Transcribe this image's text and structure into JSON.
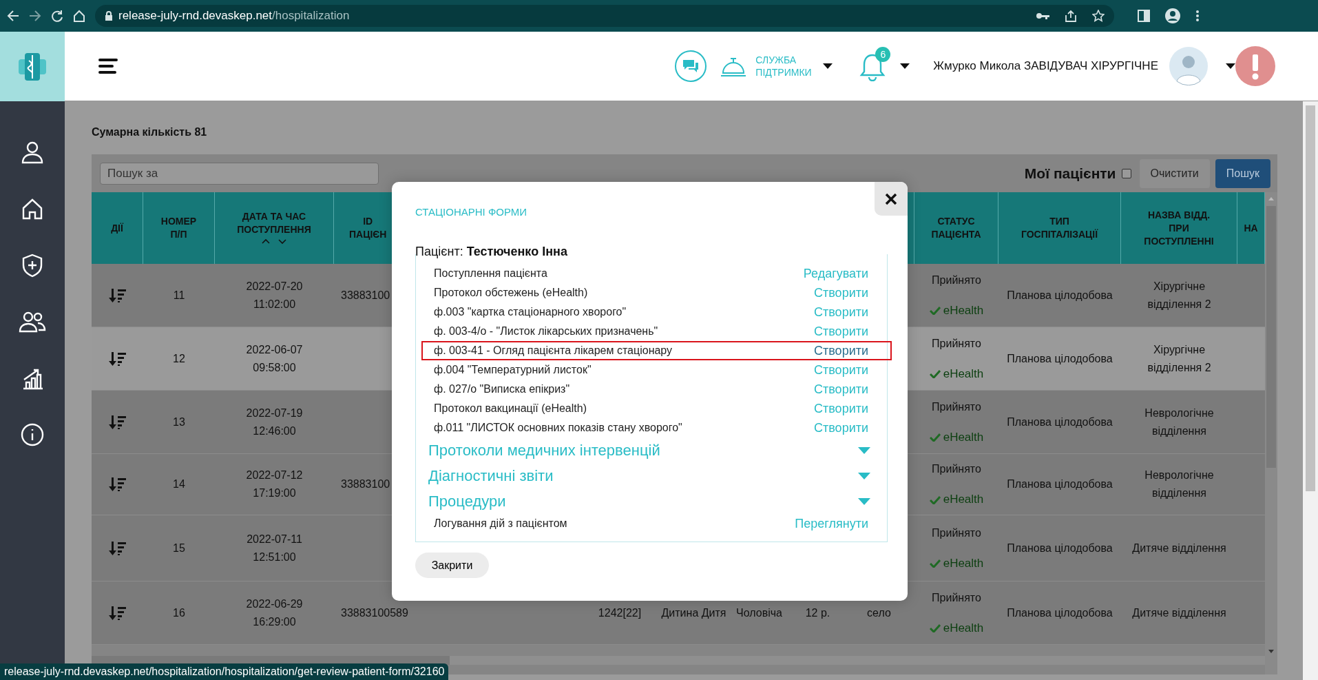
{
  "browser": {
    "address_bar": {
      "host": "release-july-rnd.devaskep.net",
      "path": "/hospitalization"
    }
  },
  "header": {
    "support_label": "СЛУЖБА ПІДТРИМКИ",
    "notification_count": "6",
    "user_name": "Жмурко Микола ЗАВІДУВАЧ ХІРУРГІЧНЕ"
  },
  "summary": "Сумарна кількість 81",
  "toolbar": {
    "search": {
      "placeholder": "Пошук за"
    },
    "my_patients": {
      "label": "Мої пацієнти",
      "checked": false
    },
    "clear_button": "Очистити",
    "search_button": "Пошук"
  },
  "table": {
    "columns": [
      {
        "label": "ДІЇ",
        "sortable": false
      },
      {
        "label": "НОМЕР\nП/П",
        "sortable": false
      },
      {
        "label": "ДАТА ТА ЧАС\nПОСТУПЛЕННЯ",
        "sortable": true
      },
      {
        "label": "ID\nПАЦІЄН",
        "sortable": false
      },
      {},
      {},
      {},
      {},
      {},
      {
        "label": "СТАТУС\nПАЦІЄНТА",
        "sortable": false
      },
      {
        "label": "ТИП\nГОСПІТАЛІЗАЦІЇ",
        "sortable": false
      },
      {
        "label": "НАЗВА ВІДД.\nПРИ\nПОСТУПЛЕННІ",
        "sortable": false
      },
      {
        "label": "НА",
        "sortable": false
      }
    ],
    "rows": [
      {
        "number": "11",
        "date": "2022-07-20",
        "time": "11:02:00",
        "patient_id": "33883100",
        "status": "Прийнято",
        "ehealth": "eHealth",
        "hospitalization_type": "Планова цілодобова",
        "department": "Хірургічне відділення 2",
        "highlighted": false
      },
      {
        "number": "12",
        "date": "2022-06-07",
        "time": "09:58:00",
        "status": "Прийнято",
        "ehealth": "eHealth",
        "hospitalization_type": "Планова цілодобова",
        "department": "Хірургічне відділення 2",
        "highlighted": true
      },
      {
        "number": "13",
        "date": "2022-07-19",
        "time": "12:46:00",
        "status": "Прийнято",
        "ehealth": "eHealth",
        "hospitalization_type": "Планова цілодобова",
        "department": "Неврологічне відділення",
        "highlighted": false
      },
      {
        "number": "14",
        "date": "2022-07-12",
        "time": "17:19:00",
        "patient_id": "33883100",
        "status": "Прийнято",
        "ehealth": "eHealth",
        "hospitalization_type": "Планова цілодобова",
        "department": "Неврологічне відділення",
        "highlighted": false
      },
      {
        "number": "15",
        "date": "2022-07-11",
        "time": "12:51:00",
        "status": "Прийнято",
        "ehealth": "eHealth",
        "hospitalization_type": "Планова цілодобова",
        "department": "Дитяче відділення",
        "highlighted": false
      },
      {
        "number": "16",
        "date": "2022-06-29",
        "time": "16:29:00",
        "patient_id": "33883100589",
        "column_5": "1242[22]",
        "column_6": "Дитина Дитя",
        "column_7": "Чоловіча",
        "column_8": "12 р.",
        "column_9": "село",
        "status": "Прийнято",
        "ehealth": "eHealth",
        "hospitalization_type": "Планова цілодобова",
        "department": "Дитяче відділення",
        "highlighted": false
      }
    ]
  },
  "modal": {
    "title": "СТАЦІОНАРНІ ФОРМИ",
    "patient_label": "Пацієнт:",
    "patient_name": "Тестюченко Інна",
    "items": [
      {
        "kind": "form",
        "label": "Поступлення пацієнта",
        "action": "Редагувати",
        "highlighted": false
      },
      {
        "kind": "form",
        "label": "Протокол обстежень (eHealth)",
        "action": "Створити",
        "highlighted": false
      },
      {
        "kind": "form",
        "label": "ф.003 \"картка стаціонарного хворого\"",
        "action": "Створити",
        "highlighted": false
      },
      {
        "kind": "form",
        "label": "ф. 003-4/о - \"Листок лікарських призначень\"",
        "action": "Створити",
        "highlighted": false
      },
      {
        "kind": "form",
        "label": "ф. 003-41 - Огляд пацієнта лікарем стаціонару",
        "action": "Створити",
        "highlighted": true
      },
      {
        "kind": "form",
        "label": "ф.004 \"Температурний листок\"",
        "action": "Створити",
        "highlighted": false
      },
      {
        "kind": "form",
        "label": "ф. 027/о \"Виписка епікриз\"",
        "action": "Створити",
        "highlighted": false
      },
      {
        "kind": "form",
        "label": "Протокол вакцинації (eHealth)",
        "action": "Створити",
        "highlighted": false
      },
      {
        "kind": "form",
        "label": "ф.011 \"ЛИСТОК основних показів стану хворого\"",
        "action": "Створити",
        "highlighted": false
      },
      {
        "kind": "section",
        "label": "Протоколи медичних інтервенцій",
        "expanded": false
      },
      {
        "kind": "section",
        "label": "Діагностичні звіти",
        "expanded": false
      },
      {
        "kind": "section",
        "label": "Процедури",
        "expanded": false
      },
      {
        "kind": "form",
        "label": "Логування дій з пацієнтом",
        "action": "Переглянути",
        "highlighted": false
      }
    ],
    "close_button": "Закрити"
  },
  "status_url": "release-july-rnd.devaskep.net/hospitalization/hospitalization/get-review-patient-form/32160"
}
